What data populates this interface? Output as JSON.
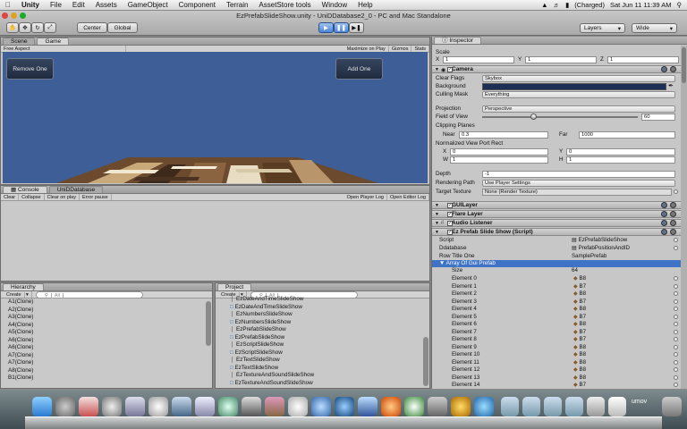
{
  "menubar": {
    "app": "Unity",
    "items": [
      "File",
      "Edit",
      "Assets",
      "GameObject",
      "Component",
      "Terrain",
      "AssetStore tools",
      "Window",
      "Help"
    ],
    "battery": "(Charged)",
    "clock": "Sat Jun 11  11:39 AM"
  },
  "window": {
    "title": "EzPrefabSlideShow.unity - UniDDatabase2_0 - PC and Mac Standalone"
  },
  "toolbar": {
    "pivot": "Center",
    "space": "Global",
    "layers": "Layers",
    "layout": "Wide"
  },
  "scene_tabs": {
    "scene": "Scene",
    "game": "Game"
  },
  "game_bar": {
    "aspect": "Free Aspect",
    "maximize": "Maximize on Play",
    "gizmos": "Gizmos",
    "stats": "Stats"
  },
  "game": {
    "remove_button": "Remove One",
    "add_button": "Add One"
  },
  "console": {
    "tab": "Console",
    "tab2": "UniDDatabase",
    "buttons": [
      "Clear",
      "Collapse",
      "Clear on play",
      "Error pause"
    ],
    "right_buttons": [
      "Open Player Log",
      "Open Editor Log"
    ]
  },
  "hierarchy": {
    "tab": "Hierarchy",
    "create": "Create",
    "search": "All",
    "items": [
      "A1(Clone)",
      "A2(Clone)",
      "A3(Clone)",
      "A4(Clone)",
      "A5(Clone)",
      "A6(Clone)",
      "A6(Clone)",
      "A7(Clone)",
      "A7(Clone)",
      "A8(Clone)",
      "B1(Clone)"
    ]
  },
  "project": {
    "tab": "Project",
    "create": "Create",
    "search": "All",
    "items": [
      "EzDateAndTimeSlideShow",
      "EzDateAndTimeSlideShow",
      "EzNumbersSlideShow",
      "EzNumbersSlideShow",
      "EzPrefabSlideShow",
      "EzPrefabSlideShow",
      "EzScriptSlideShow",
      "EzScriptSlideShow",
      "EzTextSlideShow",
      "EzTextSlideShow",
      "EzTextureAndSoundSlideShow",
      "EzTextureAndSoundSlideShow"
    ]
  },
  "inspector": {
    "tab": "Inspector",
    "scale_label": "Scale",
    "scale": {
      "x": "1",
      "y": "1",
      "z": "1"
    },
    "camera": {
      "title": "Camera",
      "clear_flags_label": "Clear Flags",
      "clear_flags": "Skybox",
      "background_label": "Background",
      "culling_label": "Culling Mask",
      "culling": "Everything",
      "projection_label": "Projection",
      "projection": "Perspective",
      "fov_label": "Field of View",
      "fov": "60",
      "fov_fraction": 0.33,
      "clipping_label": "Clipping Planes",
      "near_label": "Near",
      "near": "0.3",
      "far_label": "Far",
      "far": "1000",
      "viewport_label": "Normalized View Port Rect",
      "vp": {
        "x": "0",
        "y": "0",
        "w": "1",
        "h": "1"
      },
      "depth_label": "Depth",
      "depth": "-1",
      "rendering_label": "Rendering Path",
      "rendering": "Use Player Settings",
      "target_label": "Target Texture",
      "target": "None (Render Texture)"
    },
    "components": [
      "GUILayer",
      "Flare Layer",
      "Audio Listener",
      "Ez Prefab Slide Show (Script)"
    ],
    "script": {
      "script_label": "Script",
      "script": "EzPrefabSlideShow",
      "db_label": "Ddatabase",
      "db": "PrefabPositionAndID",
      "row_label": "Row Title One",
      "row": "SamplePrefab",
      "array_label": "Array Of Gui Prefab",
      "size_label": "Size",
      "size": "64",
      "elements": [
        {
          "name": "Element 0",
          "value": "B8"
        },
        {
          "name": "Element 1",
          "value": "B7"
        },
        {
          "name": "Element 2",
          "value": "B8"
        },
        {
          "name": "Element 3",
          "value": "B7"
        },
        {
          "name": "Element 4",
          "value": "B8"
        },
        {
          "name": "Element 5",
          "value": "B7"
        },
        {
          "name": "Element 6",
          "value": "B8"
        },
        {
          "name": "Element 7",
          "value": "B7"
        },
        {
          "name": "Element 8",
          "value": "B7"
        },
        {
          "name": "Element 9",
          "value": "B8"
        },
        {
          "name": "Element 10",
          "value": "B8"
        },
        {
          "name": "Element 11",
          "value": "B8"
        },
        {
          "name": "Element 12",
          "value": "B8"
        },
        {
          "name": "Element 13",
          "value": "B8"
        },
        {
          "name": "Element 14",
          "value": "B7"
        }
      ]
    }
  },
  "dock_label": "umov"
}
